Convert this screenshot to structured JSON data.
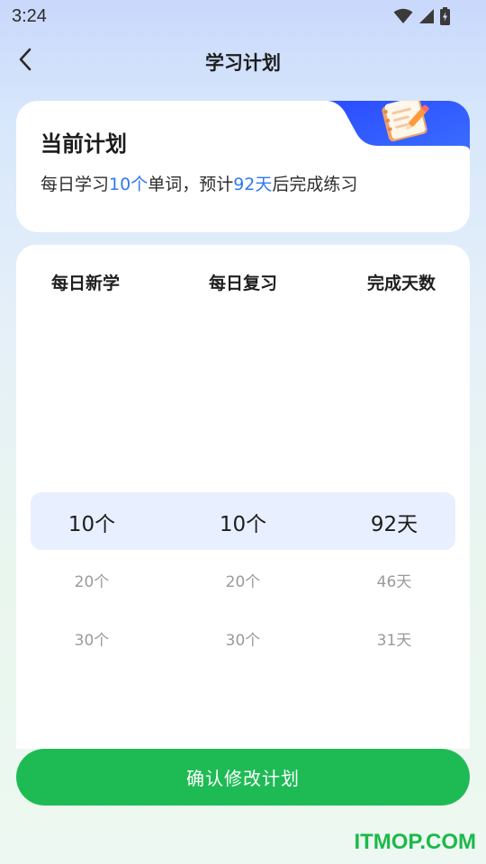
{
  "status_bar": {
    "time": "3:24",
    "icons": [
      "wifi-icon",
      "cellular-signal-icon",
      "battery-charging-icon"
    ]
  },
  "nav": {
    "title": "学习计划",
    "back_icon": "chevron-left-icon"
  },
  "current_plan": {
    "title": "当前计划",
    "desc_prefix": "每日学习",
    "daily_count": "10个",
    "desc_mid": "单词，预计",
    "days": "92天",
    "desc_suffix": "后完成练习",
    "decoration_icon": "notebook-pencil-icon",
    "accent_color": "#2f79f6"
  },
  "picker": {
    "headers": [
      "每日新学",
      "每日复习",
      "完成天数"
    ],
    "columns": [
      {
        "name": "daily-new",
        "options": [
          "10个",
          "20个",
          "30个"
        ],
        "selected_index": 0
      },
      {
        "name": "daily-review",
        "options": [
          "10个",
          "20个",
          "30个"
        ],
        "selected_index": 0
      },
      {
        "name": "completion-days",
        "options": [
          "92天",
          "46天",
          "31天"
        ],
        "selected_index": 0
      }
    ]
  },
  "confirm_button": {
    "label": "确认修改计划",
    "color": "#1ebb55"
  },
  "watermark": "ITMOP.COM"
}
